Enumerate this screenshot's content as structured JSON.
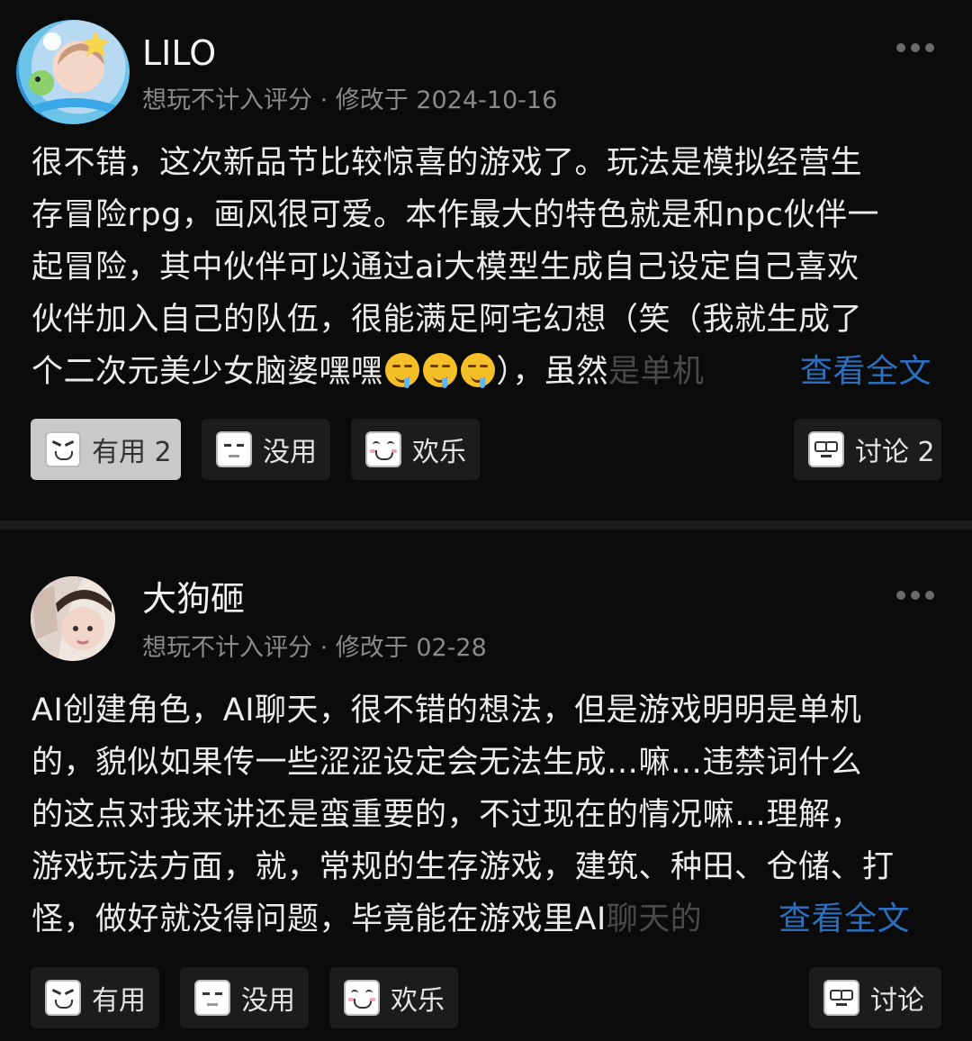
{
  "reviews": [
    {
      "username": "LILO",
      "meta": "想玩不计入评分 · 修改于 2024-10-16",
      "lines": [
        "很不错，这次新品节比较惊喜的游戏了。玩法是模拟经营生",
        "存冒险rpg，画风很可爱。本作最大的特色就是和npc伙伴一",
        "起冒险，其中伙伴可以通过ai大模型生成自己设定自己喜欢",
        "伙伴加入自己的队伍，很能满足阿宅幻想（笑（我就生成了"
      ],
      "last_line_prefix": "个二次元美少女脑婆嘿嘿",
      "last_line_suffix": "），虽然",
      "last_line_fade": "是单机",
      "read_more": "查看全文",
      "actions": {
        "useful": "有用 2",
        "useless": "没用",
        "funny": "欢乐",
        "discuss": "讨论 2"
      }
    },
    {
      "username": "大狗砸",
      "meta": "想玩不计入评分 · 修改于 02-28",
      "lines": [
        "AI创建角色，AI聊天，很不错的想法，但是游戏明明是单机",
        "的，貌似如果传一些涩涩设定会无法生成…嘛…违禁词什么",
        "的这点对我来讲还是蛮重要的，不过现在的情况嘛…理解，",
        "游戏玩法方面，就，常规的生存游戏，建筑、种田、仓储、打"
      ],
      "last_line_prefix": "怪，做好就没得问题，毕竟能在游戏里AI",
      "last_line_suffix": "",
      "last_line_fade": "聊天的",
      "read_more": "查看全文",
      "actions": {
        "useful": "有用",
        "useless": "没用",
        "funny": "欢乐",
        "discuss": "讨论"
      }
    }
  ],
  "colors": {
    "link": "#2b6fbf",
    "active_button": "#c9c9c9",
    "button": "#1c1c1c"
  }
}
